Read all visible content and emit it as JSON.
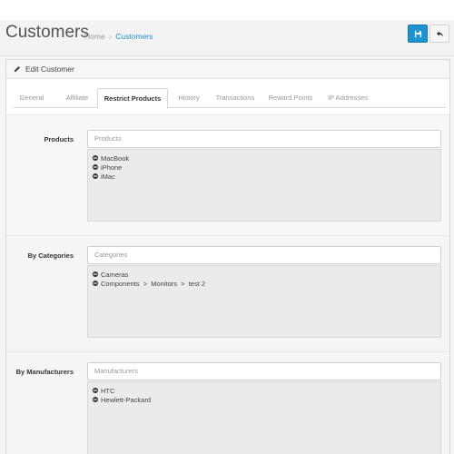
{
  "header": {
    "title": "Customers",
    "breadcrumb": [
      {
        "label": "Home"
      },
      {
        "label": "Customers"
      }
    ],
    "breadcrumb_sep": "›"
  },
  "panel": {
    "heading": "Edit Customer"
  },
  "tabs": [
    {
      "label": "General"
    },
    {
      "label": "Affiliate"
    },
    {
      "label": "Restrict Products"
    },
    {
      "label": "History"
    },
    {
      "label": "Transactions"
    },
    {
      "label": "Reward Points"
    },
    {
      "label": "IP Addresses"
    }
  ],
  "sections": {
    "products": {
      "label": "Products",
      "placeholder": "Products",
      "items": [
        "MacBook",
        "iPhone",
        "iMac"
      ]
    },
    "categories": {
      "label": "By Categories",
      "placeholder": "Categories",
      "items": [
        "Cameras",
        "Components  >  Monitors  >  test 2"
      ]
    },
    "manufacturers": {
      "label": "By Manufacturers",
      "placeholder": "Manufacturers",
      "items": [
        "HTC",
        "Hewlett-Packard"
      ]
    }
  },
  "colors": {
    "primary": "#1e91cf",
    "background": "#f5f5f5"
  },
  "icons": {
    "heading": "pencil-icon",
    "save": "save-icon",
    "back": "reply-icon",
    "remove": "minus-circle-icon"
  }
}
